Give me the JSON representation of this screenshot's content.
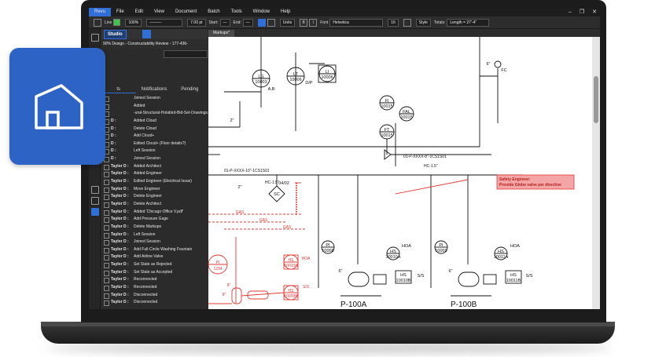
{
  "menu": {
    "items": [
      "Revu",
      "File",
      "Edit",
      "View",
      "Document",
      "Batch",
      "Tools",
      "Window",
      "Help"
    ],
    "window_controls": [
      "–",
      "❐",
      "✕"
    ]
  },
  "toolbar": {
    "line_label": "Line",
    "opacity": "100%",
    "width": "7.00 pt",
    "start_label": "Start:",
    "end_label": "End:",
    "units_label": "Units",
    "font_label": "Font",
    "font_value": "Helvetica",
    "font_size": "16",
    "style_label": "Style",
    "totals_label": "Totals:",
    "totals_value": "Length = 27'-4\""
  },
  "studio": {
    "button": "Studio",
    "session_title": "90% Design - Constructability Review - 177-436-",
    "tab_a": "ts",
    "tab_notifications": "Notifications",
    "tab_pending": "Pending"
  },
  "log": [
    {
      "who": "",
      "act": "Joined Session"
    },
    {
      "who": "",
      "act": "Added"
    },
    {
      "who": "",
      "act": "-ural-Structural-Holabird-Bid-Set-Drawings."
    },
    {
      "who": "D :",
      "act": "Added Cloud"
    },
    {
      "who": "D :",
      "act": "Delete Cloud"
    },
    {
      "who": "D :",
      "act": "Add Cloud+"
    },
    {
      "who": "D :",
      "act": "Edited Cloud+ (Floor details?)"
    },
    {
      "who": "D :",
      "act": "Left Session"
    },
    {
      "who": "D :",
      "act": "Joined Session"
    },
    {
      "who": "Taylor D :",
      "act": "Added Architect"
    },
    {
      "who": "Taylor D :",
      "act": "Added Engineer"
    },
    {
      "who": "Taylor D :",
      "act": "Edited Engineer (Electrical Issue)"
    },
    {
      "who": "Taylor D :",
      "act": "Move Engineer"
    },
    {
      "who": "Taylor D :",
      "act": "Delete Engineer"
    },
    {
      "who": "Taylor D :",
      "act": "Delete Architect"
    },
    {
      "who": "Taylor D :",
      "act": "Added 'Chicago Office V.pdf'"
    },
    {
      "who": "Taylor D :",
      "act": "Add Pressure Gage"
    },
    {
      "who": "Taylor D :",
      "act": "Delete Markups"
    },
    {
      "who": "Taylor D :",
      "act": "Left Session"
    },
    {
      "who": "Taylor D :",
      "act": "Joined Session"
    },
    {
      "who": "Taylor D :",
      "act": "Add Full-Circle Washing Fountain"
    },
    {
      "who": "Taylor D :",
      "act": "Add Airline Valve"
    },
    {
      "who": "Taylor D :",
      "act": "Set State as Rejected"
    },
    {
      "who": "Taylor D :",
      "act": "Set State as Accepted"
    },
    {
      "who": "Taylor D :",
      "act": "Reconnected"
    },
    {
      "who": "Taylor D :",
      "act": "Reconnected"
    },
    {
      "who": "Taylor D :",
      "act": "Disconnected"
    },
    {
      "who": "Taylor D :",
      "act": "Disconnected"
    }
  ],
  "document": {
    "tab": "Markups*"
  },
  "drawing": {
    "lg": "LG",
    "lg_num": "10003",
    "lg_sub": "A,B",
    "lt": "LT",
    "lt_num": "10006",
    "lt_sub": "D/P",
    "li": "LI",
    "li_num": "10006",
    "fi": "FI",
    "fi_num": "10015",
    "fal": "FAL",
    "fal_num": "10015",
    "ft": "FT",
    "ft_num": "10015",
    "size_2": "2\"",
    "size_6": "6\"",
    "size_8": "8\"",
    "fc": "FC",
    "line_upper": "01-P-XXXX-8\"-1CS1S01",
    "line_lower": "01-P-XXXX-10\"-1CS1S01",
    "hc": "HC-1.5\"",
    "sc": "SC",
    "sc_num": "04/02",
    "callout_line1": "Safety Engineer:",
    "callout_line2": "Provide Globe valve per directive",
    "gas": "GAS",
    "pi_red": "PI",
    "pi_red_num": "1234",
    "hs": "HS",
    "hs_a": "10010A",
    "hs_b": "10009B",
    "hoa": "HOA",
    "ss": "S/S",
    "pi1": "PI",
    "pi1_num": "10008",
    "pi2": "PI",
    "pi2_num": "10009",
    "hs1_num": "10010A",
    "hs2_num": "10010B",
    "hs3_num": "10011A",
    "hs4_num": "10011B",
    "pump_a": "P-100A",
    "pump_b": "P-100B"
  },
  "colors": {
    "accent": "#2f6fd6",
    "badge": "#2d63c4",
    "markup_red": "#e53935"
  }
}
